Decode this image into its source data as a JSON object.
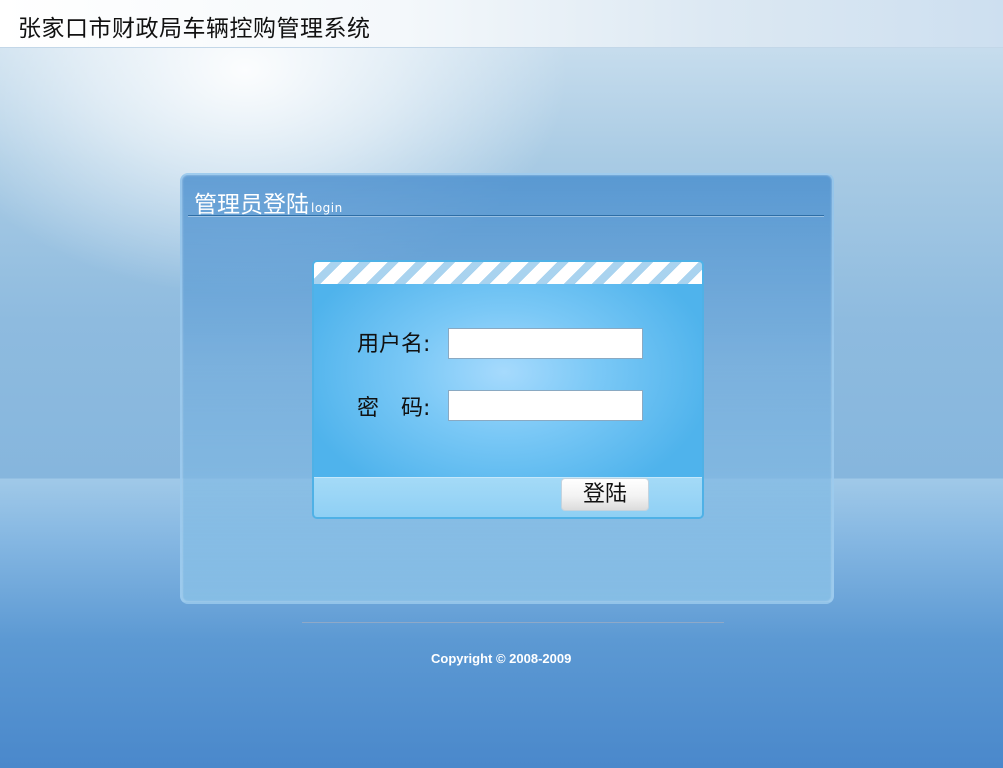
{
  "header": {
    "title": "张家口市财政局车辆控购管理系统"
  },
  "panel": {
    "title": "管理员登陆",
    "subtitle": "login"
  },
  "form": {
    "username_label": "用户名:",
    "username_value": "",
    "password_label": "密　码:",
    "password_value": "",
    "submit_label": "登陆"
  },
  "footer": {
    "copyright": "Copyright ©  2008-2009"
  }
}
